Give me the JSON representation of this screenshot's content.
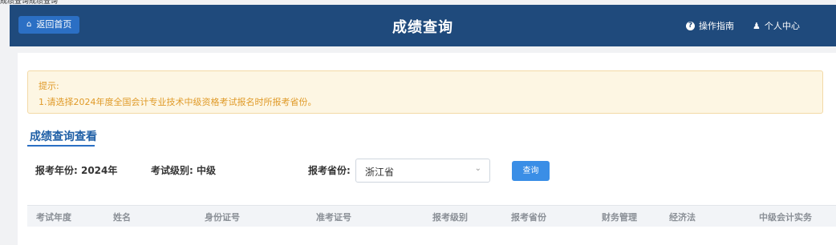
{
  "breadcrumb": "成绩查询成绩查询",
  "header": {
    "home_label": "返回首页",
    "title": "成绩查询",
    "guide_label": "操作指南",
    "profile_label": "个人中心"
  },
  "tip": {
    "title": "提示:",
    "line1": "1.请选择2024年度全国会计专业技术中级资格考试报名时所报考省份。"
  },
  "tab": {
    "label": "成绩查询查看"
  },
  "form": {
    "year_label": "报考年份: 2024年",
    "level_label": "考试级别: 中级",
    "province_label": "报考省份:",
    "province_value": "浙江省",
    "query_label": "查询"
  },
  "table": {
    "headers": [
      "考试年度",
      "姓名",
      "身份证号",
      "准考证号",
      "报考级别",
      "报考省份",
      "财务管理",
      "经济法",
      "中级会计实务"
    ]
  },
  "colors": {
    "header_bg": "#1f4a7c",
    "accent": "#2b6fc4",
    "tip_text": "#e09a28",
    "tip_bg": "#fdf6e3"
  }
}
